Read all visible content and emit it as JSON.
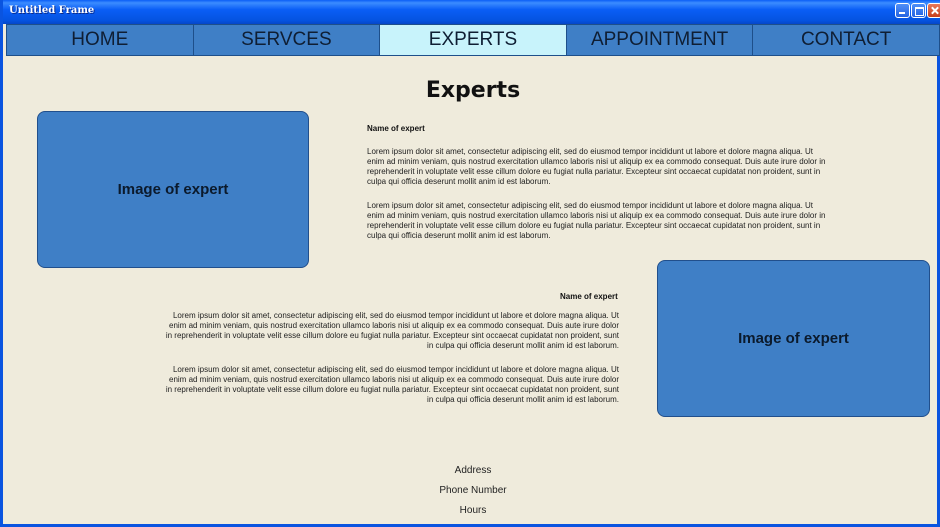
{
  "window": {
    "title": "Untitled Frame"
  },
  "nav": {
    "items": [
      {
        "label": "HOME"
      },
      {
        "label": "SERVCES"
      },
      {
        "label": "EXPERTS"
      },
      {
        "label": "APPOINTMENT"
      },
      {
        "label": "CONTACT"
      }
    ],
    "active": "EXPERTS"
  },
  "main": {
    "title": "Experts",
    "experts": [
      {
        "image_label": "Image of expert",
        "name": "Name of expert",
        "paragraphs": [
          "Lorem ipsum dolor sit amet, consectetur adipiscing elit, sed do eiusmod tempor incididunt ut labore et dolore magna aliqua. Ut enim ad minim veniam, quis nostrud exercitation ullamco laboris nisi ut aliquip ex ea commodo consequat. Duis aute irure dolor in reprehenderit in voluptate velit esse cillum dolore eu fugiat nulla pariatur. Excepteur sint occaecat cupidatat non proident, sunt in culpa qui officia deserunt mollit anim id est laborum.",
          "Lorem ipsum dolor sit amet, consectetur adipiscing elit, sed do eiusmod tempor incididunt ut labore et dolore magna aliqua. Ut enim ad minim veniam, quis nostrud exercitation ullamco laboris nisi ut aliquip ex ea commodo consequat. Duis aute irure dolor in reprehenderit in voluptate velit esse cillum dolore eu fugiat nulla pariatur. Excepteur sint occaecat cupidatat non proident, sunt in culpa qui officia deserunt mollit anim id est laborum."
        ]
      },
      {
        "image_label": "Image of expert",
        "name": "Name of expert",
        "paragraphs": [
          "Lorem ipsum dolor sit amet, consectetur adipiscing elit, sed do eiusmod tempor incididunt ut labore et dolore magna aliqua. Ut enim ad minim veniam, quis nostrud exercitation ullamco laboris nisi ut aliquip ex ea commodo consequat. Duis aute irure dolor in reprehenderit in voluptate velit esse cillum dolore eu fugiat nulla pariatur. Excepteur sint occaecat cupidatat non proident, sunt in culpa qui officia deserunt mollit anim id est laborum.",
          "Lorem ipsum dolor sit amet, consectetur adipiscing elit, sed do eiusmod tempor incididunt ut labore et dolore magna aliqua. Ut enim ad minim veniam, quis nostrud exercitation ullamco laboris nisi ut aliquip ex ea commodo consequat. Duis aute irure dolor in reprehenderit in voluptate velit esse cillum dolore eu fugiat nulla pariatur. Excepteur sint occaecat cupidatat non proident, sunt in culpa qui officia deserunt mollit anim id est laborum."
        ]
      }
    ]
  },
  "footer": {
    "address": "Address",
    "phone": "Phone Number",
    "hours": "Hours"
  },
  "colors": {
    "titlebar": "#0a5ef6",
    "nav_bg": "#3f7fc6",
    "nav_active": "#c8f3fb",
    "page_bg": "#efebdc",
    "image_box": "#3f7fc6"
  }
}
